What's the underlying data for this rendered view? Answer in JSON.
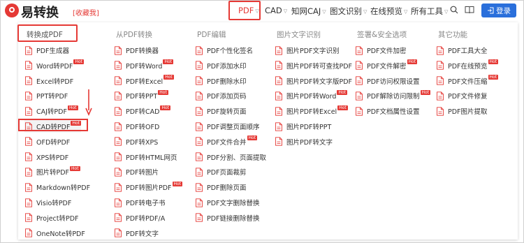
{
  "header": {
    "logo_text": "易转换",
    "fav_label": "[收藏我]",
    "nav": [
      {
        "label": "PDF",
        "active": true
      },
      {
        "label": "CAD"
      },
      {
        "label": "知网CAJ"
      },
      {
        "label": "图文识别"
      },
      {
        "label": "在线预览"
      },
      {
        "label": "所有工具"
      }
    ],
    "login_label": "登录",
    "colors": {
      "accent": "#e53935",
      "login": "#2a6fdb"
    }
  },
  "menu": {
    "hot_label": "Hot",
    "columns": [
      {
        "title": "转换成PDF",
        "items": [
          {
            "label": "PDF生成器",
            "hot": false
          },
          {
            "label": "Word转PDF",
            "hot": true
          },
          {
            "label": "Excel转PDF",
            "hot": false
          },
          {
            "label": "PPT转PDF",
            "hot": false
          },
          {
            "label": "CAJ转PDF",
            "hot": true
          },
          {
            "label": "CAD转PDF",
            "hot": true,
            "selected": true
          },
          {
            "label": "OFD转PDF",
            "hot": false
          },
          {
            "label": "XPS转PDF",
            "hot": false
          },
          {
            "label": "图片转PDF",
            "hot": true
          },
          {
            "label": "Markdown转PDF",
            "hot": false
          },
          {
            "label": "Visio转PDF",
            "hot": false
          },
          {
            "label": "Project转PDF",
            "hot": false
          },
          {
            "label": "OneNote转PDF",
            "hot": false
          }
        ]
      },
      {
        "title": "从PDF转换",
        "items": [
          {
            "label": "PDF转换器",
            "hot": false
          },
          {
            "label": "PDF转Word",
            "hot": true
          },
          {
            "label": "PDF转Excel",
            "hot": true
          },
          {
            "label": "PDF转PPT",
            "hot": true
          },
          {
            "label": "PDF转CAD",
            "hot": true
          },
          {
            "label": "PDF转OFD",
            "hot": false
          },
          {
            "label": "PDF转XPS",
            "hot": false
          },
          {
            "label": "PDF转HTML网页",
            "hot": false
          },
          {
            "label": "PDF转图片",
            "hot": false
          },
          {
            "label": "PDF转图片PDF",
            "hot": true
          },
          {
            "label": "PDF转电子书",
            "hot": false
          },
          {
            "label": "PDF转PDF/A",
            "hot": false
          },
          {
            "label": "PDF转文字",
            "hot": false
          }
        ]
      },
      {
        "title": "PDF编辑",
        "items": [
          {
            "label": "PDF个性化签名",
            "hot": false
          },
          {
            "label": "PDF添加水印",
            "hot": false
          },
          {
            "label": "PDF删除水印",
            "hot": false
          },
          {
            "label": "PDF添加页码",
            "hot": false
          },
          {
            "label": "PDF旋转页面",
            "hot": false
          },
          {
            "label": "PDF调整页面顺序",
            "hot": false
          },
          {
            "label": "PDF文件合并",
            "hot": true
          },
          {
            "label": "PDF分割、页面提取",
            "hot": false
          },
          {
            "label": "PDF页面裁剪",
            "hot": false
          },
          {
            "label": "PDF删除页面",
            "hot": false
          },
          {
            "label": "PDF文字删除替换",
            "hot": false
          },
          {
            "label": "PDF链接删除替换",
            "hot": false
          }
        ]
      },
      {
        "title": "图片文字识别",
        "items": [
          {
            "label": "图片PDF文字识别",
            "hot": false
          },
          {
            "label": "图片PDF转可查找PDF",
            "hot": false
          },
          {
            "label": "图片PDF转文字版PDF",
            "hot": false
          },
          {
            "label": "图片PDF转Word",
            "hot": true
          },
          {
            "label": "图片PDF转Excel",
            "hot": true
          },
          {
            "label": "图片PDF转PPT",
            "hot": false
          },
          {
            "label": "图片PDF转文字",
            "hot": false
          }
        ]
      },
      {
        "title": "签署&安全选项",
        "items": [
          {
            "label": "PDF文件加密",
            "hot": false
          },
          {
            "label": "PDF文件解密",
            "hot": true
          },
          {
            "label": "PDF访问权限设置",
            "hot": false
          },
          {
            "label": "PDF解除访问限制",
            "hot": true
          },
          {
            "label": "PDF文档属性设置",
            "hot": false
          }
        ]
      },
      {
        "title": "其它功能",
        "items": [
          {
            "label": "PDF工具大全",
            "hot": false
          },
          {
            "label": "PDF在线预览",
            "hot": true
          },
          {
            "label": "PDF文件压缩",
            "hot": true
          },
          {
            "label": "PDF文件修复",
            "hot": false
          },
          {
            "label": "PDF图片提取",
            "hot": false
          }
        ]
      }
    ]
  }
}
